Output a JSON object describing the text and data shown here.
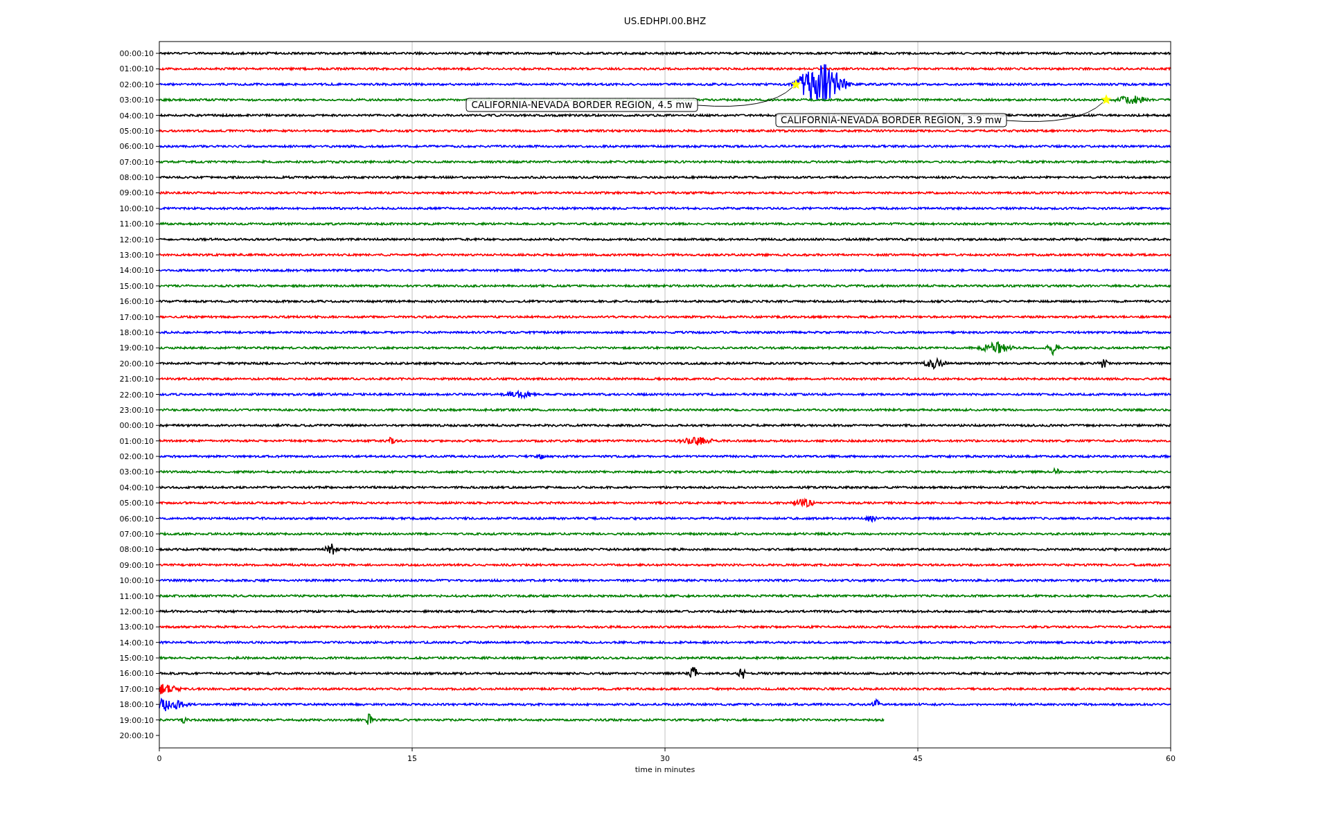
{
  "title": "US.EDHPI.00.BHZ",
  "rows": [
    {
      "label": "00:00:10",
      "color": "#000000",
      "level": 1
    },
    {
      "label": "01:00:10",
      "color": "#ff0000",
      "level": 1
    },
    {
      "label": "02:00:10",
      "color": "#0000ff",
      "level": 1
    },
    {
      "label": "03:00:10",
      "color": "#008000",
      "level": 1
    },
    {
      "label": "04:00:10",
      "color": "#000000",
      "level": 1
    },
    {
      "label": "05:00:10",
      "color": "#ff0000",
      "level": 1
    },
    {
      "label": "06:00:10",
      "color": "#0000ff",
      "level": 1
    },
    {
      "label": "07:00:10",
      "color": "#008000",
      "level": 1
    },
    {
      "label": "08:00:10",
      "color": "#000000",
      "level": 1
    },
    {
      "label": "09:00:10",
      "color": "#ff0000",
      "level": 1
    },
    {
      "label": "10:00:10",
      "color": "#0000ff",
      "level": 1
    },
    {
      "label": "11:00:10",
      "color": "#008000",
      "level": 1
    },
    {
      "label": "12:00:10",
      "color": "#000000",
      "level": 1
    },
    {
      "label": "13:00:10",
      "color": "#ff0000",
      "level": 1
    },
    {
      "label": "14:00:10",
      "color": "#0000ff",
      "level": 1
    },
    {
      "label": "15:00:10",
      "color": "#008000",
      "level": 1
    },
    {
      "label": "16:00:10",
      "color": "#000000",
      "level": 1
    },
    {
      "label": "17:00:10",
      "color": "#ff0000",
      "level": 1
    },
    {
      "label": "18:00:10",
      "color": "#0000ff",
      "level": 1
    },
    {
      "label": "19:00:10",
      "color": "#008000",
      "level": 1
    },
    {
      "label": "20:00:10",
      "color": "#000000",
      "level": 1
    },
    {
      "label": "21:00:10",
      "color": "#ff0000",
      "level": 1
    },
    {
      "label": "22:00:10",
      "color": "#0000ff",
      "level": 1
    },
    {
      "label": "23:00:10",
      "color": "#008000",
      "level": 1
    },
    {
      "label": "00:00:10",
      "color": "#000000",
      "level": 1
    },
    {
      "label": "01:00:10",
      "color": "#ff0000",
      "level": 1
    },
    {
      "label": "02:00:10",
      "color": "#0000ff",
      "level": 1
    },
    {
      "label": "03:00:10",
      "color": "#008000",
      "level": 1
    },
    {
      "label": "04:00:10",
      "color": "#000000",
      "level": 1
    },
    {
      "label": "05:00:10",
      "color": "#ff0000",
      "level": 1
    },
    {
      "label": "06:00:10",
      "color": "#0000ff",
      "level": 1
    },
    {
      "label": "07:00:10",
      "color": "#008000",
      "level": 1
    },
    {
      "label": "08:00:10",
      "color": "#000000",
      "level": 1
    },
    {
      "label": "09:00:10",
      "color": "#ff0000",
      "level": 1
    },
    {
      "label": "10:00:10",
      "color": "#0000ff",
      "level": 1
    },
    {
      "label": "11:00:10",
      "color": "#008000",
      "level": 1
    },
    {
      "label": "12:00:10",
      "color": "#000000",
      "level": 1
    },
    {
      "label": "13:00:10",
      "color": "#ff0000",
      "level": 1
    },
    {
      "label": "14:00:10",
      "color": "#0000ff",
      "level": 1
    },
    {
      "label": "15:00:10",
      "color": "#008000",
      "level": 1
    },
    {
      "label": "16:00:10",
      "color": "#000000",
      "level": 1
    },
    {
      "label": "17:00:10",
      "color": "#ff0000",
      "level": 1
    },
    {
      "label": "18:00:10",
      "color": "#0000ff",
      "level": 1
    },
    {
      "label": "19:00:10",
      "color": "#008000",
      "level": 0.717
    },
    {
      "label": "20:00:10"
    }
  ],
  "xticks": [
    "0",
    "15",
    "30",
    "45",
    "60"
  ],
  "xlabel": "time in minutes",
  "annotations": [
    {
      "text": "CALIFORNIA-NEVADA BORDER REGION, 4.5 mw"
    },
    {
      "text": "CALIFORNIA-NEVADA BORDER REGION, 3.9 mw"
    }
  ]
}
